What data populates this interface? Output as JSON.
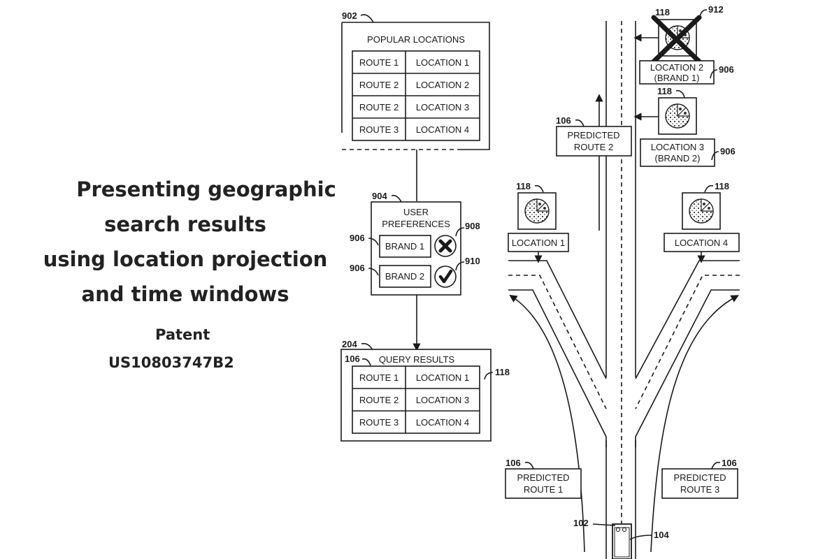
{
  "title": {
    "lines": [
      "Presenting geographic",
      "search results",
      "using location projection",
      "and time windows"
    ],
    "patent_label": "Patent",
    "patent_number": "US10803747B2"
  },
  "popular_locations": {
    "ref": "902",
    "heading": "POPULAR LOCATIONS",
    "rows": [
      {
        "route": "ROUTE 1",
        "location": "LOCATION 1"
      },
      {
        "route": "ROUTE 2",
        "location": "LOCATION 2"
      },
      {
        "route": "ROUTE 2",
        "location": "LOCATION 3"
      },
      {
        "route": "ROUTE 3",
        "location": "LOCATION 4"
      }
    ]
  },
  "user_preferences": {
    "ref": "904",
    "heading_line1": "USER",
    "heading_line2": "PREFERENCES",
    "brands": [
      {
        "label": "BRAND 1",
        "ref": "906",
        "status": "excluded",
        "status_ref": "908",
        "icon": "x-circle-icon"
      },
      {
        "label": "BRAND 2",
        "ref": "906",
        "status": "included",
        "status_ref": "910",
        "icon": "check-circle-icon"
      }
    ]
  },
  "query_results": {
    "ref": "204",
    "heading": "QUERY RESULTS",
    "route_ref": "106",
    "table_ref": "118",
    "rows": [
      {
        "route": "ROUTE 1",
        "location": "LOCATION 1"
      },
      {
        "route": "ROUTE 2",
        "location": "LOCATION 3"
      },
      {
        "route": "ROUTE 3",
        "location": "LOCATION 4"
      }
    ]
  },
  "map": {
    "predicted_routes": [
      {
        "ref": "106",
        "line1": "PREDICTED",
        "line2": "ROUTE 1"
      },
      {
        "ref": "106",
        "line1": "PREDICTED",
        "line2": "ROUTE 2"
      },
      {
        "ref": "106",
        "line1": "PREDICTED",
        "line2": "ROUTE 3"
      }
    ],
    "locations": [
      {
        "ref": "118",
        "line1": "LOCATION 1",
        "line2": "",
        "icon": "pizza-icon",
        "crossed": false
      },
      {
        "ref": "118",
        "line1": "LOCATION 2",
        "line2": "(BRAND 1)",
        "label_ref": "906",
        "cross_ref": "912",
        "icon": "pizza-icon",
        "crossed": true
      },
      {
        "ref": "118",
        "line1": "LOCATION 3",
        "line2": "(BRAND 2)",
        "label_ref": "906",
        "icon": "pizza-icon",
        "crossed": false
      },
      {
        "ref": "118",
        "line1": "LOCATION 4",
        "line2": "",
        "icon": "pizza-icon",
        "crossed": false
      }
    ],
    "vehicle_ref": "102",
    "road_ref": "104"
  }
}
